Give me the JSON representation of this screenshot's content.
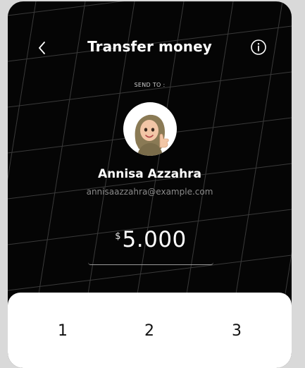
{
  "header": {
    "title": "Transfer money",
    "back_icon": "chevron-left-icon",
    "info_icon": "info-circle-icon"
  },
  "recipient": {
    "send_to_label": "SEND TO :",
    "name": "Annisa Azzahra",
    "email": "annisaazzahra@example.com",
    "avatar_icon": "memoji-avatar"
  },
  "transfer": {
    "currency_symbol": "$",
    "amount": "5.000"
  },
  "keypad": {
    "keys": [
      "1",
      "2",
      "3"
    ]
  },
  "colors": {
    "background": "#050505",
    "text_primary": "#ffffff",
    "text_secondary": "#8a8a8a",
    "keypad_bg": "#ffffff"
  }
}
